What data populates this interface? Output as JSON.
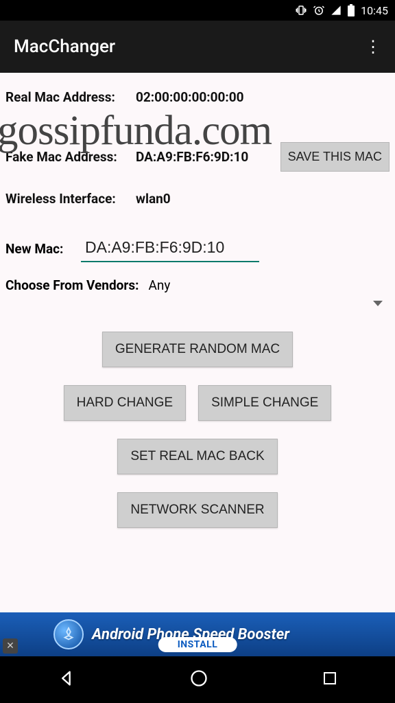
{
  "status": {
    "time": "10:45"
  },
  "header": {
    "title": "MacChanger"
  },
  "fields": {
    "real_mac_label": "Real Mac Address:",
    "real_mac_value": "02:00:00:00:00:00",
    "fake_mac_label": "Fake Mac Address:",
    "fake_mac_value": "DA:A9:FB:F6:9D:10",
    "wireless_label": "Wireless Interface:",
    "wireless_value": "wlan0",
    "new_mac_label": "New Mac:",
    "new_mac_value": "DA:A9:FB:F6:9D:10",
    "vendor_label": "Choose From Vendors:",
    "vendor_value": "Any"
  },
  "buttons": {
    "save": "SAVE THIS MAC",
    "generate": "GENERATE RANDOM MAC",
    "hard": "HARD CHANGE",
    "simple": "SIMPLE CHANGE",
    "set_real": "SET REAL MAC BACK",
    "scanner": "NETWORK SCANNER"
  },
  "watermark": "gossipfunda.com",
  "ad": {
    "text": "Android Phone Speed Booster",
    "install": "INSTALL"
  }
}
